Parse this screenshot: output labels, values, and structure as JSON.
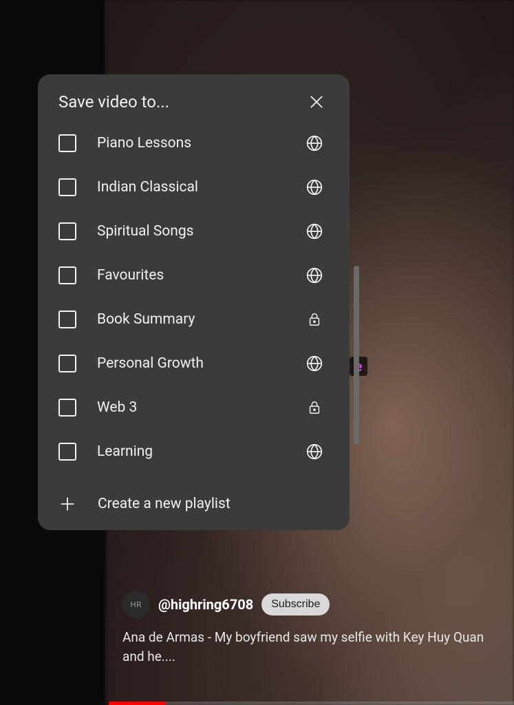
{
  "dialog": {
    "title": "Save video to...",
    "create_label": "Create a new playlist",
    "playlists": [
      {
        "label": "Piano Lessons",
        "privacy": "public"
      },
      {
        "label": "Indian Classical",
        "privacy": "public"
      },
      {
        "label": "Spiritual Songs",
        "privacy": "public"
      },
      {
        "label": "Favourites",
        "privacy": "public"
      },
      {
        "label": "Book Summary",
        "privacy": "private"
      },
      {
        "label": "Personal Growth",
        "privacy": "public"
      },
      {
        "label": "Web 3",
        "privacy": "private"
      },
      {
        "label": "Learning",
        "privacy": "public"
      }
    ]
  },
  "video": {
    "channel_avatar_text": "HR",
    "channel_handle": "@highring6708",
    "subscribe_label": "Subscribe",
    "title": "Ana de Armas - My boyfriend saw my selfie with Key Huy Quan and he....",
    "subtitle_fragment": "e"
  },
  "colors": {
    "dialog_bg": "#3b3b3b",
    "progress": "#ff0000"
  }
}
